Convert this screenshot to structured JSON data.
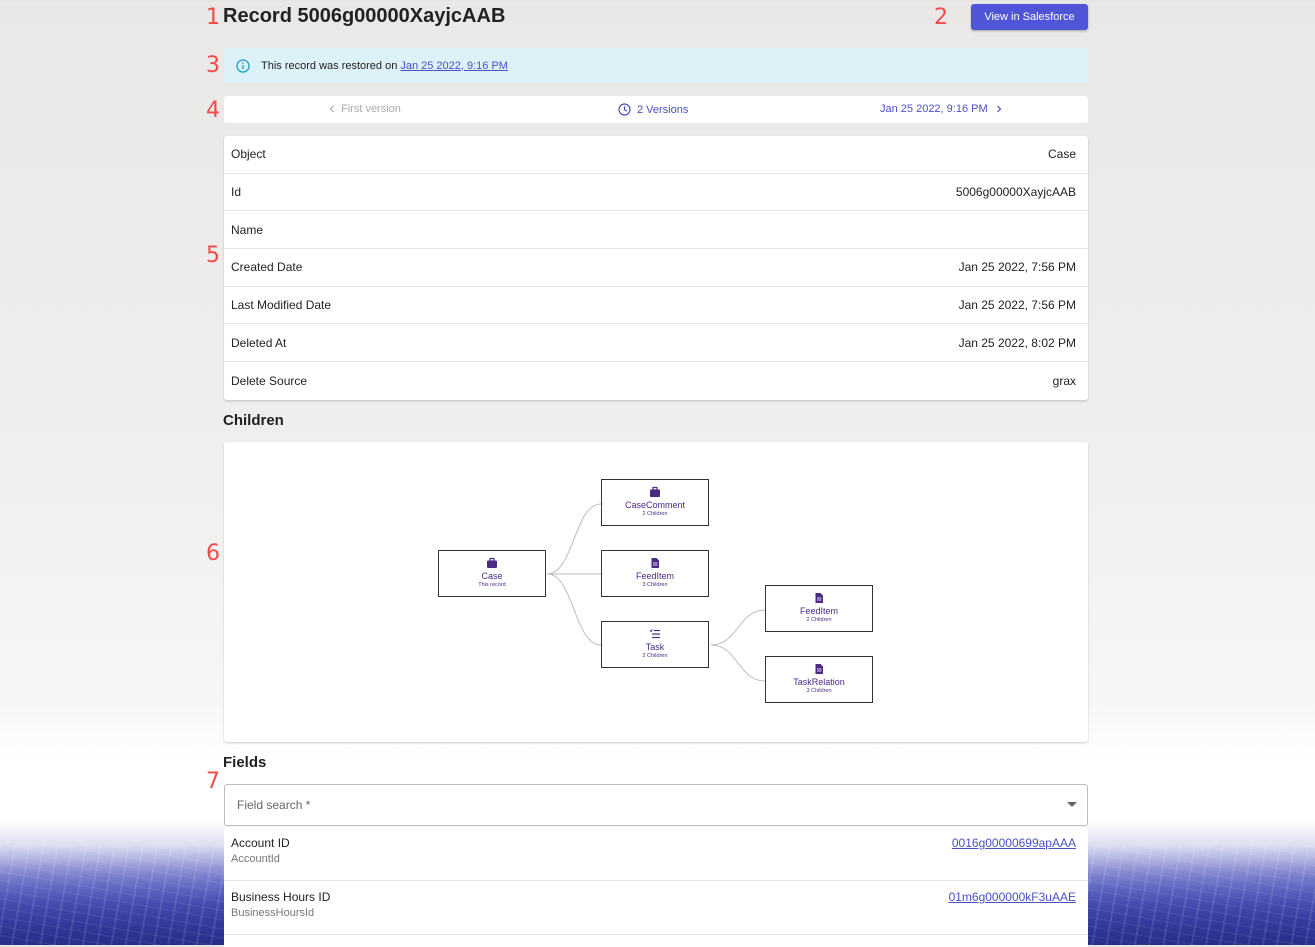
{
  "markers": [
    "1",
    "2",
    "3",
    "4",
    "5",
    "6",
    "7"
  ],
  "header": {
    "title": "Record 5006g00000XayjcAAB",
    "sf_button": "View in Salesforce"
  },
  "alert": {
    "text": "This record was restored on",
    "link": "Jan 25 2022, 9:16 PM"
  },
  "versions": {
    "prev": "First version",
    "count": "2 Versions",
    "next": "Jan 25 2022, 9:16 PM"
  },
  "details": [
    {
      "label": "Object",
      "value": "Case"
    },
    {
      "label": "Id",
      "value": "5006g00000XayjcAAB"
    },
    {
      "label": "Name",
      "value": ""
    },
    {
      "label": "Created Date",
      "value": "Jan 25 2022, 7:56 PM"
    },
    {
      "label": "Last Modified Date",
      "value": "Jan 25 2022, 7:56 PM"
    },
    {
      "label": "Deleted At",
      "value": "Jan 25 2022, 8:02 PM"
    },
    {
      "label": "Delete Source",
      "value": "grax"
    }
  ],
  "children": {
    "title": "Children",
    "nodes": [
      {
        "label": "Case",
        "sub": "This record",
        "icon": "briefcase-icon"
      },
      {
        "label": "CaseComment",
        "sub": "2 Children",
        "icon": "briefcase-icon"
      },
      {
        "label": "FeedItem",
        "sub": "3 Children",
        "icon": "document-icon"
      },
      {
        "label": "Task",
        "sub": "2 Children",
        "icon": "tasklist-icon"
      },
      {
        "label": "FeedItem",
        "sub": "2 Children",
        "icon": "document-icon"
      },
      {
        "label": "TaskRelation",
        "sub": "3 Children",
        "icon": "document-icon"
      }
    ]
  },
  "fields": {
    "title": "Fields",
    "search_placeholder": "Field search *",
    "rows": [
      {
        "name": "Account ID",
        "api": "AccountId",
        "value": "0016g00000699apAAA"
      },
      {
        "name": "Business Hours ID",
        "api": "BusinessHoursId",
        "value": "01m6g000000kF3uAAE"
      }
    ]
  },
  "colors": {
    "accent": "#5055d8",
    "link": "#4a4fc4",
    "alert_bg": "#dcf2f8",
    "node_text": "#4b2a86",
    "marker": "#f44a4a"
  }
}
